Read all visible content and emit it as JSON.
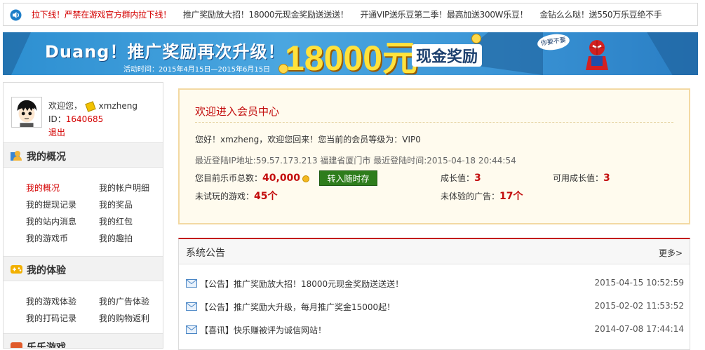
{
  "ticker": {
    "items": [
      "拉下线！严禁在游戏官方群内拉下线！",
      "推广奖励放大招！18000元现金奖励送送送！",
      "开通VIP送乐豆第二季！最高加送300W乐豆！",
      "金钻么么哒！送550万乐豆绝不手"
    ]
  },
  "banner": {
    "headline": "Duang！推广奖励再次升级！",
    "amount": "18000元",
    "cash_label": "现金奖励",
    "dates": "活动时间：2015年4月15日—2015年6月15日",
    "sticker": "你要不要"
  },
  "user": {
    "welcome_prefix": "欢迎您，",
    "username": "xmzheng",
    "id_label": "ID：",
    "id_value": "1640685",
    "logout": "退出"
  },
  "sections": [
    {
      "title": "我的概况",
      "links": [
        "我的概况",
        "我的帐户明细",
        "我的提现记录",
        "我的奖品",
        "我的站内消息",
        "我的红包",
        "我的游戏币",
        "我的趣拍"
      ]
    },
    {
      "title": "我的体验",
      "links": [
        "我的游戏体验",
        "我的广告体验",
        "我的打码记录",
        "我的购物返利"
      ]
    },
    {
      "title": "乐乐游戏"
    }
  ],
  "welcome": {
    "title": "欢迎进入会员中心",
    "greeting": "您好！xmzheng，欢迎您回来！您当前的会员等级为：VIP0",
    "last_login": "最近登陆IP地址:59.57.173.213 福建省厦门市 最近登陆时间:2015-04-18 20:44:54",
    "coins_label": "您目前乐币总数：",
    "coins_value": "40,000",
    "convert_button": "转入随时存",
    "growth_label": "成长值：",
    "growth_value": "3",
    "usable_label": "可用成长值：",
    "usable_value": "3",
    "untried_label": "未试玩的游戏：",
    "untried_value": "45个",
    "ads_label": "未体验的广告：",
    "ads_value": "17个"
  },
  "notice": {
    "title": "系统公告",
    "more": "更多>",
    "rows": [
      {
        "text": "【公告】推广奖励放大招！18000元现金奖励送送送！",
        "time": "2015-04-15 10:52:59"
      },
      {
        "text": "【公告】推广奖励大升级，每月推广奖金15000起！",
        "time": "2015-02-02 11:53:52"
      },
      {
        "text": "【喜讯】快乐赚被评为诚信网站！",
        "time": "2014-07-08 17:44:14"
      }
    ]
  },
  "colors": {
    "accent_red": "#c30d0d",
    "banner_blue": "#3b95d6",
    "button_green": "#2e7d1c"
  }
}
